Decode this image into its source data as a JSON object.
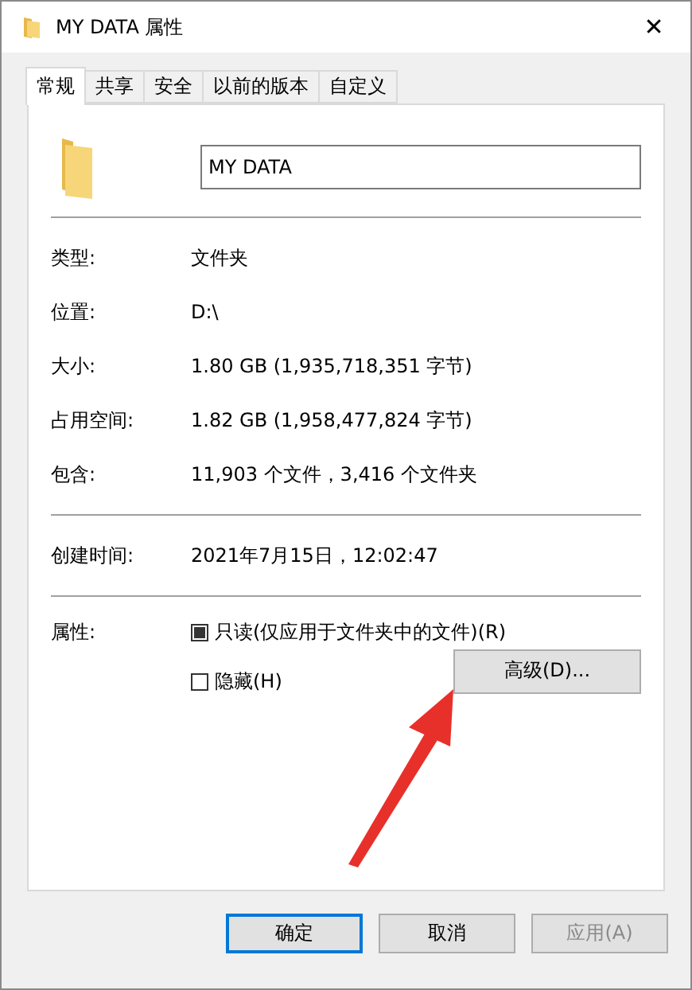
{
  "window": {
    "title": "MY DATA 属性",
    "close": "✕"
  },
  "tabs": [
    {
      "label": "常规",
      "selected": true
    },
    {
      "label": "共享",
      "selected": false
    },
    {
      "label": "安全",
      "selected": false
    },
    {
      "label": "以前的版本",
      "selected": false
    },
    {
      "label": "自定义",
      "selected": false
    }
  ],
  "name_field": {
    "value": "MY DATA"
  },
  "groups": [
    [
      {
        "label": "类型:",
        "value": "文件夹"
      },
      {
        "label": "位置:",
        "value": "D:\\"
      },
      {
        "label": "大小:",
        "value": "1.80 GB (1,935,718,351 字节)"
      },
      {
        "label": "占用空间:",
        "value": "1.82 GB (1,958,477,824 字节)"
      },
      {
        "label": "包含:",
        "value": "11,903 个文件，3,416 个文件夹"
      }
    ],
    [
      {
        "label": "创建时间:",
        "value": "2021年7月15日，12:02:47"
      }
    ]
  ],
  "attributes": {
    "label": "属性:",
    "options": [
      {
        "label": "只读(仅应用于文件夹中的文件)(R)",
        "mixed": true
      },
      {
        "label": "隐藏(H)",
        "mixed": false
      }
    ],
    "advanced_button": "高级(D)..."
  },
  "buttons": [
    {
      "label": "确定",
      "default": true,
      "disabled": false
    },
    {
      "label": "取消",
      "default": false,
      "disabled": false
    },
    {
      "label": "应用(A)",
      "default": false,
      "disabled": true
    }
  ],
  "annotation": {
    "kind": "arrow"
  }
}
